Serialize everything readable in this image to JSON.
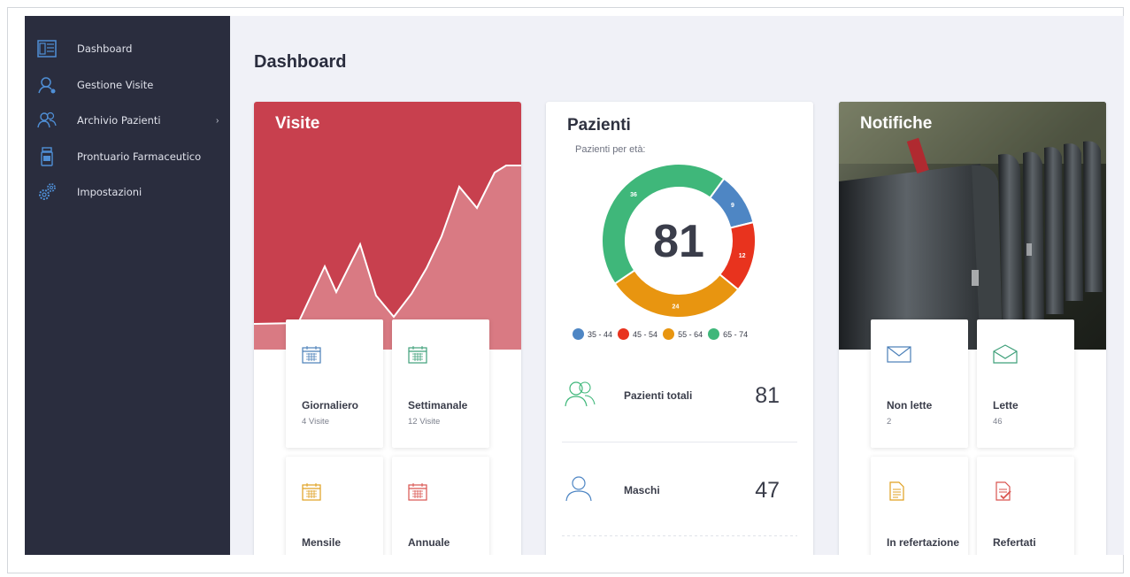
{
  "sidebar": {
    "items": [
      {
        "label": "Dashboard",
        "icon": "dashboard-icon"
      },
      {
        "label": "Gestione Visite",
        "icon": "user-search-icon"
      },
      {
        "label": "Archivio Pazienti",
        "icon": "users-icon",
        "chevron": "›"
      },
      {
        "label": "Prontuario Farmaceutico",
        "icon": "medicine-bottle-icon"
      },
      {
        "label": "Impostazioni",
        "icon": "gears-icon"
      }
    ]
  },
  "main": {
    "title": "Dashboard"
  },
  "visite": {
    "title": "Visite",
    "tiles": [
      {
        "title": "Giornaliero",
        "sub": "4 Visite",
        "icon": "calendar-icon",
        "color": "#4a7fb8"
      },
      {
        "title": "Settimanale",
        "sub": "12 Visite",
        "icon": "calendar-icon",
        "color": "#3fa07a"
      },
      {
        "title": "Mensile",
        "sub": "",
        "icon": "calendar-icon",
        "color": "#e0a020"
      },
      {
        "title": "Annuale",
        "sub": "",
        "icon": "calendar-icon",
        "color": "#d9534f"
      }
    ]
  },
  "pazienti": {
    "title": "Pazienti",
    "subtitle": "Pazienti per età:",
    "total_center": "81",
    "chart_data": {
      "type": "pie",
      "categories": [
        "35 - 44",
        "45 - 54",
        "55 - 64",
        "65 - 74"
      ],
      "values": [
        9,
        12,
        24,
        36
      ],
      "colors": [
        "#4e86c4",
        "#e8331e",
        "#e89510",
        "#3fb77a"
      ]
    },
    "stats": [
      {
        "label": "Pazienti totali",
        "value": "81",
        "icon": "users-icon"
      },
      {
        "label": "Maschi",
        "value": "47",
        "icon": "user-icon"
      }
    ]
  },
  "notifiche": {
    "title": "Notifiche",
    "tiles": [
      {
        "title": "Non lette",
        "sub": "2",
        "icon": "envelope-closed-icon",
        "color": "#4a7fb8"
      },
      {
        "title": "Lette",
        "sub": "46",
        "icon": "envelope-open-icon",
        "color": "#3fa07a"
      },
      {
        "title": "In refertazione",
        "sub": "",
        "icon": "document-icon",
        "color": "#e0a020"
      },
      {
        "title": "Refertati",
        "sub": "",
        "icon": "document-check-icon",
        "color": "#d9534f"
      }
    ]
  },
  "colors": {
    "sidebar_bg": "#2a2d3e",
    "accent_red": "#c8404e",
    "main_bg": "#f0f1f7"
  }
}
